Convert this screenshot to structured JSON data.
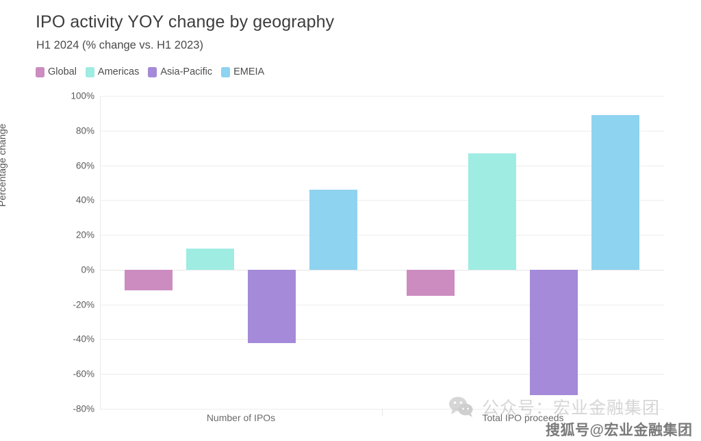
{
  "header": {
    "title": "IPO activity YOY change by geography",
    "subtitle": "H1 2024 (% change vs. H1 2023)"
  },
  "legend": {
    "position": "top-left",
    "items": [
      {
        "label": "Global",
        "color": "#cc8cc0",
        "icon": "legend-swatch"
      },
      {
        "label": "Americas",
        "color": "#9eece2",
        "icon": "legend-swatch"
      },
      {
        "label": "Asia-Pacific",
        "color": "#a48ad8",
        "icon": "legend-swatch"
      },
      {
        "label": "EMEIA",
        "color": "#8ed3f0",
        "icon": "legend-swatch"
      }
    ]
  },
  "axes": {
    "y_title": "Percentage change",
    "y_ticks": [
      "100%",
      "80%",
      "60%",
      "40%",
      "20%",
      "0%",
      "-20%",
      "-40%",
      "-60%",
      "-80%"
    ],
    "x_ticks": [
      "Number of IPOs",
      "Total IPO proceeds"
    ]
  },
  "watermarks": {
    "wechat": "公众号：宏业金融集团",
    "sohu": "搜狐号@宏业金融集团"
  },
  "chart_data": {
    "type": "bar",
    "title": "IPO activity YOY change by geography",
    "subtitle": "H1 2024 (% change vs. H1 2023)",
    "xlabel": "",
    "ylabel": "Percentage change",
    "ylim": [
      -80,
      100
    ],
    "ytick_step": 20,
    "grid": true,
    "legend_position": "top-left",
    "categories": [
      "Number of IPOs",
      "Total IPO proceeds"
    ],
    "series": [
      {
        "name": "Global",
        "color": "#cc8cc0",
        "values": [
          -12,
          -15
        ]
      },
      {
        "name": "Americas",
        "color": "#9eece2",
        "values": [
          12,
          67
        ]
      },
      {
        "name": "Asia-Pacific",
        "color": "#a48ad8",
        "values": [
          -42,
          -72
        ]
      },
      {
        "name": "EMEIA",
        "color": "#8ed3f0",
        "values": [
          46,
          89
        ]
      }
    ]
  }
}
